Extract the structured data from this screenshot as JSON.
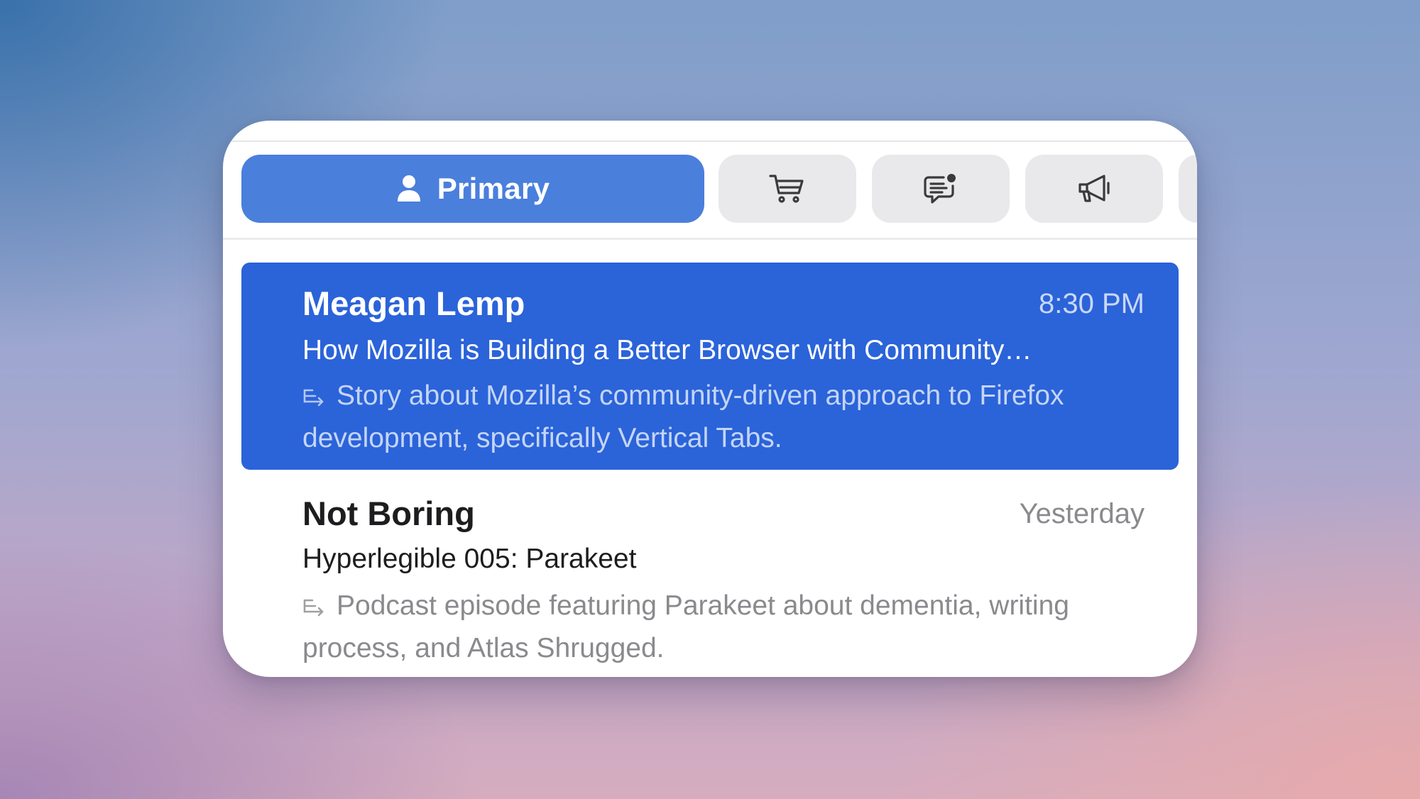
{
  "tabs": {
    "primary_label": "Primary",
    "items": [
      {
        "name": "primary",
        "icon": "person-icon",
        "label": "Primary",
        "selected": true
      },
      {
        "name": "shopping",
        "icon": "cart-icon"
      },
      {
        "name": "messages",
        "icon": "chat-bubble-badge-icon"
      },
      {
        "name": "promotions",
        "icon": "megaphone-icon"
      }
    ]
  },
  "messages": [
    {
      "sender": "Meagan Lemp",
      "time": "8:30 PM",
      "subject": "How Mozilla is Building a Better Browser with Community…",
      "summary_icon": "summary-icon",
      "preview": "Story about Mozilla’s community-driven approach to Firefox development, specifically Vertical Tabs.",
      "selected": true
    },
    {
      "sender": "Not Boring",
      "time": "Yesterday",
      "subject": "Hyperlegible 005: Parakeet",
      "summary_icon": "summary-icon",
      "preview": "Podcast episode featuring Parakeet about dementia, writing process, and Atlas Shrugged.",
      "selected": false
    }
  ],
  "colors": {
    "accent_tab": "#4a7fdc",
    "selected_row": "#2b63d9",
    "tab_inactive": "#e9e9ec"
  }
}
